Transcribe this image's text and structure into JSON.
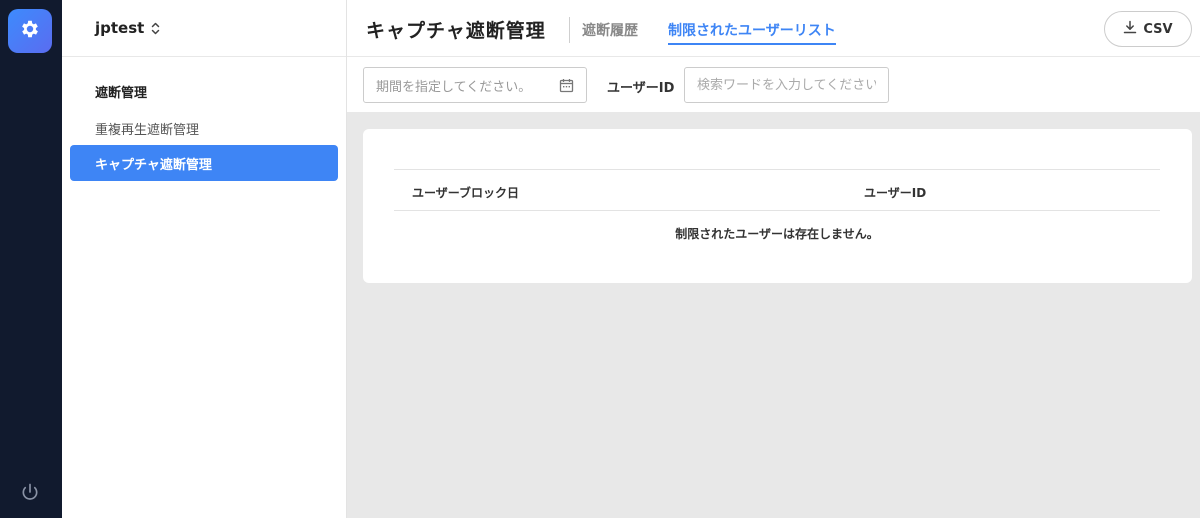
{
  "rail": {
    "app_icon": "gear-icon",
    "power_icon": "power-icon"
  },
  "sidebar": {
    "workspace_name": "jptest",
    "group_title": "遮断管理",
    "items": [
      {
        "label": "重複再生遮断管理",
        "active": false
      },
      {
        "label": "キャプチャ遮断管理",
        "active": true
      }
    ]
  },
  "header": {
    "title": "キャプチャ遮断管理",
    "tabs": [
      {
        "label": "遮断履歴",
        "active": false
      },
      {
        "label": "制限されたユーザーリスト",
        "active": true
      }
    ],
    "csv_label": "CSV"
  },
  "filters": {
    "date_placeholder": "期間を指定してください。",
    "user_id_label": "ユーザーID",
    "search_placeholder": "検索ワードを入力してください"
  },
  "table": {
    "columns": [
      "ユーザーブロック日",
      "ユーザーID"
    ],
    "empty_message": "制限されたユーザーは存在しません。"
  },
  "colors": {
    "accent": "#3e85f5",
    "rail_bg": "#111a2e",
    "content_bg": "#e8e8e8"
  }
}
